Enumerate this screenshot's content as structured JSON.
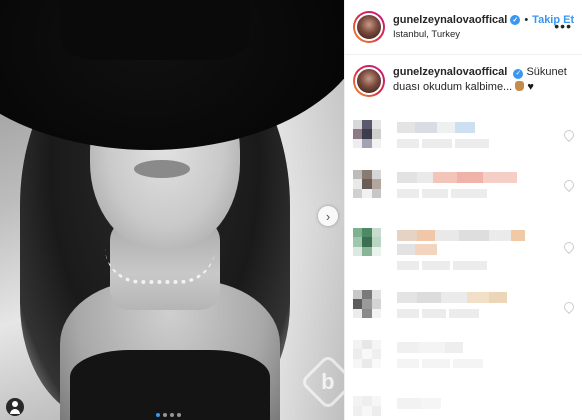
{
  "post": {
    "photo": {
      "next_icon": "chevron-right-icon",
      "carousel_count": 4,
      "carousel_active": 1,
      "tag_icon": "person-tag-icon",
      "watermark_letter": "b"
    }
  },
  "header": {
    "username": "gunelzeynalovaoffical",
    "separator": "•",
    "follow_label": "Takip Et",
    "location": "Istanbul, Turkey",
    "more_icon": "•••"
  },
  "caption": {
    "username": "gunelzeynalovaoffical",
    "text": "Sükunet duası okudum kalbime..."
  },
  "colors": {
    "accent": "#3897f0",
    "text": "#262626",
    "divider": "#efefef"
  }
}
